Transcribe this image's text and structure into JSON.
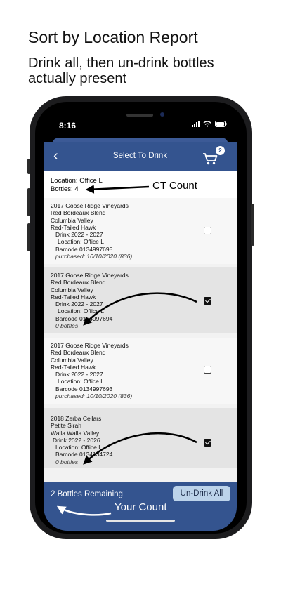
{
  "page": {
    "heading": "Sort by Location Report",
    "subheading": "Drink all, then un-drink bottles actually present"
  },
  "status_bar": {
    "time": "8:16"
  },
  "navbar": {
    "back_icon": "‹",
    "title": "Select To Drink",
    "cart_count": "2"
  },
  "location_header": {
    "location": "Location: Office L",
    "bottles": "Bottles: 4"
  },
  "bottles": [
    {
      "vintage_producer": "2017 Goose Ridge Vineyards",
      "wine": "Red Bordeaux Blend",
      "region": "Columbia Valley",
      "vineyard": "Red-Tailed Hawk",
      "drink": "Drink 2022 - 2027",
      "location": "Location: Office L",
      "barcode": "Barcode 0134997695",
      "note": "purchased: 10/10/2020 (836)",
      "checked": false
    },
    {
      "vintage_producer": "2017 Goose Ridge Vineyards",
      "wine": "Red Bordeaux Blend",
      "region": "Columbia Valley",
      "vineyard": "Red-Tailed Hawk",
      "drink": "Drink 2022 - 2027",
      "location": "Location: Office L",
      "barcode": "Barcode 0134997694",
      "note": "0 bottles",
      "checked": true
    },
    {
      "vintage_producer": "2017 Goose Ridge Vineyards",
      "wine": "Red Bordeaux Blend",
      "region": "Columbia Valley",
      "vineyard": "Red-Tailed Hawk",
      "drink": "Drink 2022 - 2027",
      "location": "Location: Office L",
      "barcode": "Barcode 0134997693",
      "note": "purchased: 10/10/2020 (836)",
      "checked": false
    },
    {
      "vintage_producer": "2018 Zerba Cellars",
      "wine": "Petite Sirah",
      "region": "Walla Walla Valley",
      "vineyard": "",
      "drink": "Drink 2022 - 2026",
      "location": "Location: Office L",
      "barcode": "Barcode 0134134724",
      "note": "0 bottles",
      "checked": true
    }
  ],
  "footer": {
    "remaining": "2 Bottles Remaining",
    "undrink_label": "Un-Drink All"
  },
  "annotations": {
    "ct_count": "CT Count",
    "your_count": "Your Count"
  },
  "colors": {
    "nav_blue": "#34548f",
    "button_light_blue": "#bcd3ea"
  }
}
